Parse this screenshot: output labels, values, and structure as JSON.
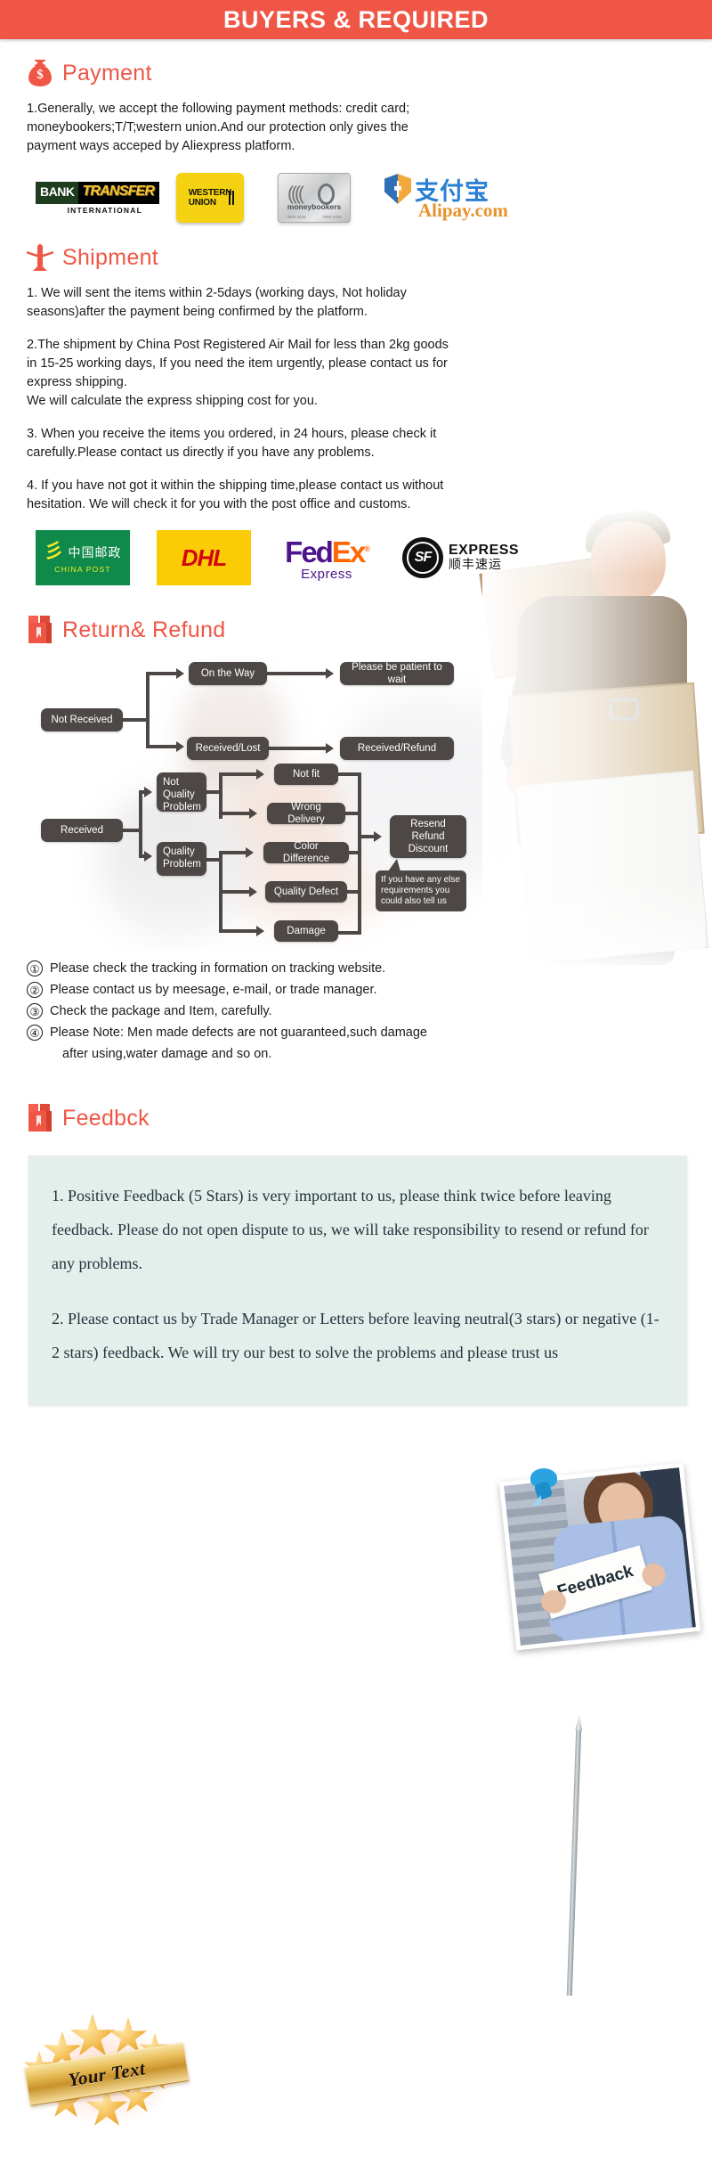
{
  "banner": {
    "title": "BUYERS & REQUIRED"
  },
  "sections": {
    "payment": {
      "heading": "Payment",
      "icon": "money-bag-icon",
      "paragraphs": [
        "1.Generally, we accept the following payment methods: credit card; moneybookers;T/T;western union.And our protection only gives the payment ways acceped by Aliexpress platform."
      ],
      "logos": [
        {
          "id": "bank-transfer",
          "bank": "BANK",
          "transfer": "TRANSFER",
          "international": "INTERNATIONAL"
        },
        {
          "id": "western-union",
          "line1": "WESTERN",
          "line2": "UNION"
        },
        {
          "id": "moneybookers",
          "name": "moneybookers",
          "sub_left": "4565 4545",
          "sub_right": "7665 0793"
        },
        {
          "id": "alipay",
          "chinese": "支付宝",
          "domain": "Alipay.com"
        }
      ]
    },
    "shipment": {
      "heading": "Shipment",
      "icon": "airplane-icon",
      "paragraphs": [
        "1. We will sent the items within 2-5days (working days, Not holiday seasons)after the payment being confirmed by the platform.",
        "2.The shipment by China Post Registered Air Mail for less than  2kg goods in 15-25 working days, If  you need the item urgently, please contact us for express shipping.",
        "We will calculate the express shipping cost for you.",
        "3. When you receive the items you ordered, in 24 hours, please check  it carefully.Please contact us directly if you have any problems.",
        "4. If you have not got it within the shipping time,please contact us without hesitation. We will check it for you with the post office and customs."
      ],
      "logos": [
        {
          "id": "china-post",
          "chinese": "中国邮政",
          "english": "CHINA POST"
        },
        {
          "id": "dhl",
          "word": "DHL"
        },
        {
          "id": "fedex",
          "fed": "Fed",
          "ex": "Ex",
          "reg": "®",
          "sub": "Express"
        },
        {
          "id": "sf-express",
          "mark": "SF",
          "line1": "EXPRESS",
          "line2": "顺丰速运"
        }
      ]
    },
    "return_refund": {
      "heading": "Return& Refund",
      "icon": "return-box-icon",
      "flow": {
        "nodes": [
          {
            "id": "not-received",
            "label": "Not Received"
          },
          {
            "id": "on-the-way",
            "label": "On the Way"
          },
          {
            "id": "please-be-patient",
            "label": "Please be patient to wait"
          },
          {
            "id": "received-lost",
            "label": "Received/Lost"
          },
          {
            "id": "received-refund",
            "label": "Received/Refund"
          },
          {
            "id": "received",
            "label": "Received"
          },
          {
            "id": "not-quality-problem",
            "label": "Not\nQuality\nProblem"
          },
          {
            "id": "quality-problem",
            "label": "Quality\nProblem"
          },
          {
            "id": "not-fit",
            "label": "Not fit"
          },
          {
            "id": "wrong-delivery",
            "label": "Wrong Delivery"
          },
          {
            "id": "color-difference",
            "label": "Color Difference"
          },
          {
            "id": "quality-defect",
            "label": "Quality Defect"
          },
          {
            "id": "damage",
            "label": "Damage"
          },
          {
            "id": "resend-refund-discount",
            "label": "Resend\nRefund\nDiscount"
          }
        ],
        "callout": "If you have any else requirements you could also tell us"
      },
      "notes": [
        {
          "num": "①",
          "text": "Please check the tracking in formation on tracking website."
        },
        {
          "num": "②",
          "text": "Please contact us by meesage, e-mail, or trade manager."
        },
        {
          "num": "③",
          "text": "Check the package and Item, carefully."
        },
        {
          "num": "④",
          "text": "Please Note: Men made defects  are not guaranteed,such damage",
          "cont": "after using,water damage and so on."
        }
      ]
    },
    "feedback": {
      "heading": "Feedbck",
      "icon": "feedback-box-icon",
      "photo_sign_text": "Feedback",
      "paragraphs": [
        "1. Positive Feedback (5 Stars) is very important to us, please think twice before leaving feedback. Please do not open dispute to us,   we will take responsibility to resend or refund for any problems.",
        "2. Please contact us by Trade Manager or Letters before leaving neutral(3 stars) or negative (1-2 stars) feedback. We will try our best to solve the problems and please trust us"
      ],
      "badge_text": "Your Text"
    }
  },
  "colors": {
    "accent": "#ef5645",
    "flow_node": "#4d4745",
    "feedback_panel": "#e4eeea",
    "banner_text": "#ffffff"
  }
}
